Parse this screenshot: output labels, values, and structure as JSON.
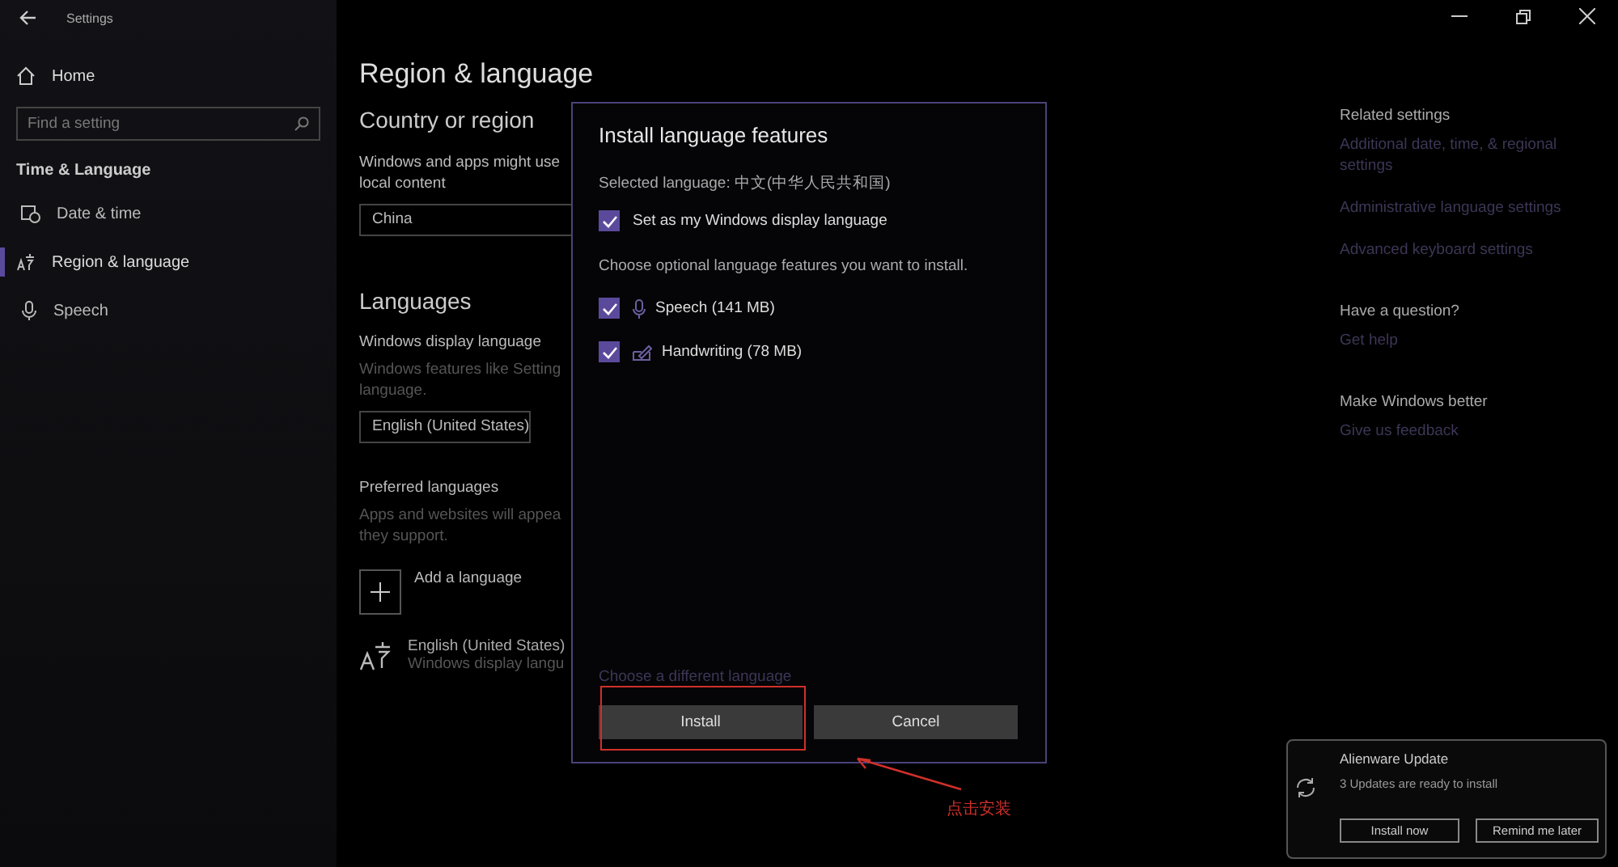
{
  "window": {
    "title": "Settings"
  },
  "sidebar": {
    "home": "Home",
    "search": {
      "placeholder": "Find a setting"
    },
    "section": "Time & Language",
    "items": [
      {
        "label": "Date & time",
        "kind": "calendar",
        "selected": false
      },
      {
        "label": "Region & language",
        "kind": "language",
        "selected": true
      },
      {
        "label": "Speech",
        "kind": "mic",
        "selected": false
      }
    ]
  },
  "main": {
    "title": "Region & language",
    "country_heading": "Country or region",
    "country_text": [
      "Windows and apps might use",
      "local content"
    ],
    "country_value": "China",
    "languages_heading": "Languages",
    "display_label": "Windows display language",
    "display_text": [
      "Windows features like Setting",
      "language."
    ],
    "display_value": "English (United States)",
    "preferred_label": "Preferred languages",
    "preferred_text": [
      "Apps and websites will appea",
      "they support."
    ],
    "add_language": "Add a language",
    "language_entry": {
      "name": "English (United States)",
      "detail": "Windows display langu"
    }
  },
  "related": [
    {
      "heading": "Related settings",
      "links": [
        [
          "Additional date, time, & regional",
          "settings"
        ],
        [
          "Administrative language settings"
        ],
        [
          "Advanced keyboard settings"
        ]
      ]
    },
    {
      "heading": "Have a question?",
      "links": [
        [
          "Get help"
        ]
      ]
    },
    {
      "heading": "Make Windows better",
      "links": [
        [
          "Give us feedback"
        ]
      ]
    }
  ],
  "dialog": {
    "title": "Install language features",
    "selected_language": "Selected language: 中文(中华人民共和国)",
    "display_option": {
      "label": "Set as my Windows display language",
      "checked": true
    },
    "prompt": "Choose optional language features you want to install.",
    "features": [
      {
        "label": "Speech (141 MB)",
        "kind": "mic",
        "checked": true
      },
      {
        "label": "Handwriting (78 MB)",
        "kind": "pen",
        "checked": true
      }
    ],
    "different_language": "Choose a different language",
    "buttons": [
      "Install",
      "Cancel"
    ]
  },
  "annotation": {
    "text": "点击安装"
  },
  "toast": {
    "title": "Alienware Update",
    "message": "3 Updates are ready to install",
    "buttons": [
      "Install now",
      "Remind me later"
    ]
  }
}
